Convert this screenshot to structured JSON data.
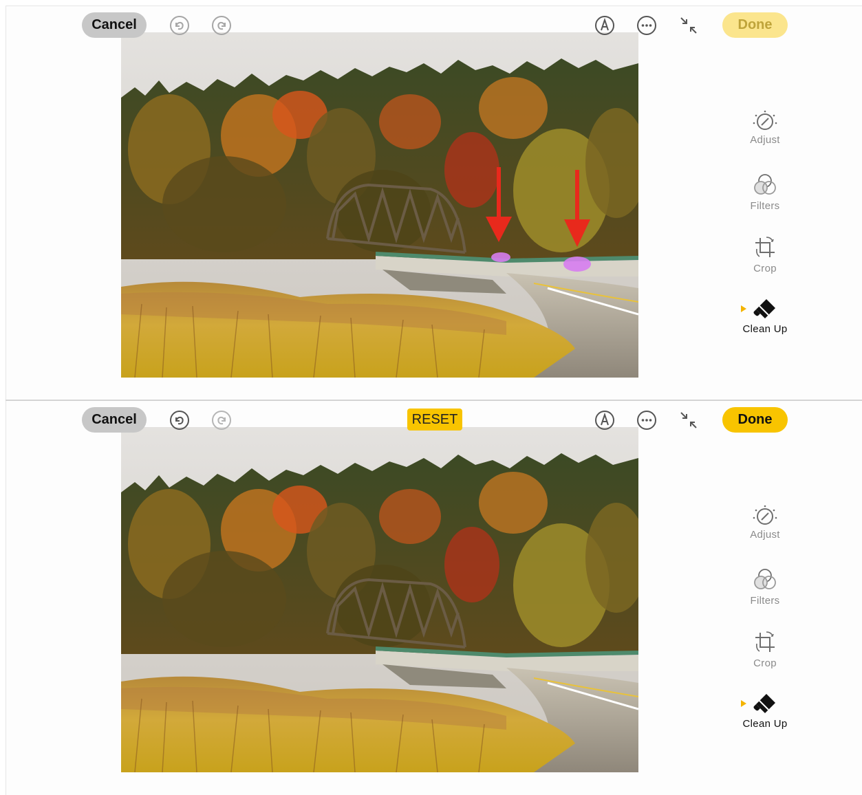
{
  "before": {
    "toolbar": {
      "cancel_label": "Cancel",
      "done_label": "Done",
      "done_state": "disabled"
    },
    "annotations": {
      "arrow_color": "#e8291c",
      "arrow_count": 2,
      "highlight_color": "#d77df0"
    }
  },
  "after": {
    "toolbar": {
      "cancel_label": "Cancel",
      "reset_label": "RESET",
      "done_label": "Done",
      "done_state": "enabled"
    }
  },
  "tools": [
    {
      "label": "Adjust",
      "icon": "adjust-dial-icon"
    },
    {
      "label": "Filters",
      "icon": "filters-circles-icon"
    },
    {
      "label": "Crop",
      "icon": "crop-rotate-icon"
    },
    {
      "label": "Clean Up",
      "icon": "eraser-icon",
      "active": true
    }
  ],
  "icons": [
    "undo-icon",
    "redo-icon",
    "markup-icon",
    "more-options-icon",
    "shrink-icon"
  ],
  "colors": {
    "accent_yellow": "#f8c400",
    "done_disabled": "#fbe58d",
    "cancel_bg": "#c7c7c7",
    "selection_marker": "#f4b400"
  }
}
